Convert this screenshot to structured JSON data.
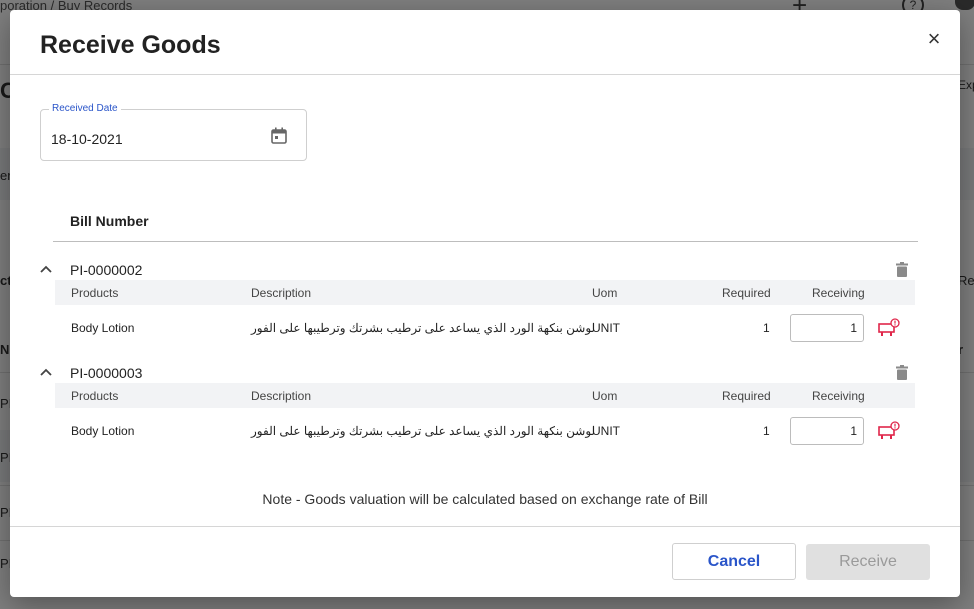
{
  "background": {
    "breadcrumb": "poration / Buy Records",
    "help_glyph": "?",
    "left_fragments": [
      "C",
      "er",
      "ct",
      "Nu",
      "PI-",
      "PI-",
      "PI-",
      "PI-"
    ],
    "right_fragments": [
      "Exp",
      "Re",
      "r"
    ]
  },
  "dialog": {
    "title": "Receive Goods",
    "close_glyph": "×",
    "received_date": {
      "label": "Received Date",
      "value": "18-10-2021"
    },
    "bill_header": "Bill Number",
    "columns": {
      "products": "Products",
      "description": "Description",
      "uom": "Uom",
      "required": "Required",
      "receiving": "Receiving"
    },
    "bills": [
      {
        "number": "PI-0000002",
        "rows": [
          {
            "product": "Body Lotion",
            "description": "لوشن بنكهة الورد الذي يساعد على ترطيب بشرتك وترطيبها على الفور",
            "uom": "UNIT",
            "required": "1",
            "receiving": "1"
          }
        ]
      },
      {
        "number": "PI-0000003",
        "rows": [
          {
            "product": "Body Lotion",
            "description": "لوشن بنكهة الورد الذي يساعد على ترطيب بشرتك وترطيبها على الفور",
            "uom": "UNIT",
            "required": "1",
            "receiving": "1"
          }
        ]
      }
    ],
    "note": "Note - Goods valuation will be calculated based on exchange rate of Bill",
    "cancel_label": "Cancel",
    "receive_label": "Receive"
  },
  "colors": {
    "accent": "#2a55c9",
    "alert": "#e0264a",
    "disabled_bg": "#e0e0e0"
  }
}
